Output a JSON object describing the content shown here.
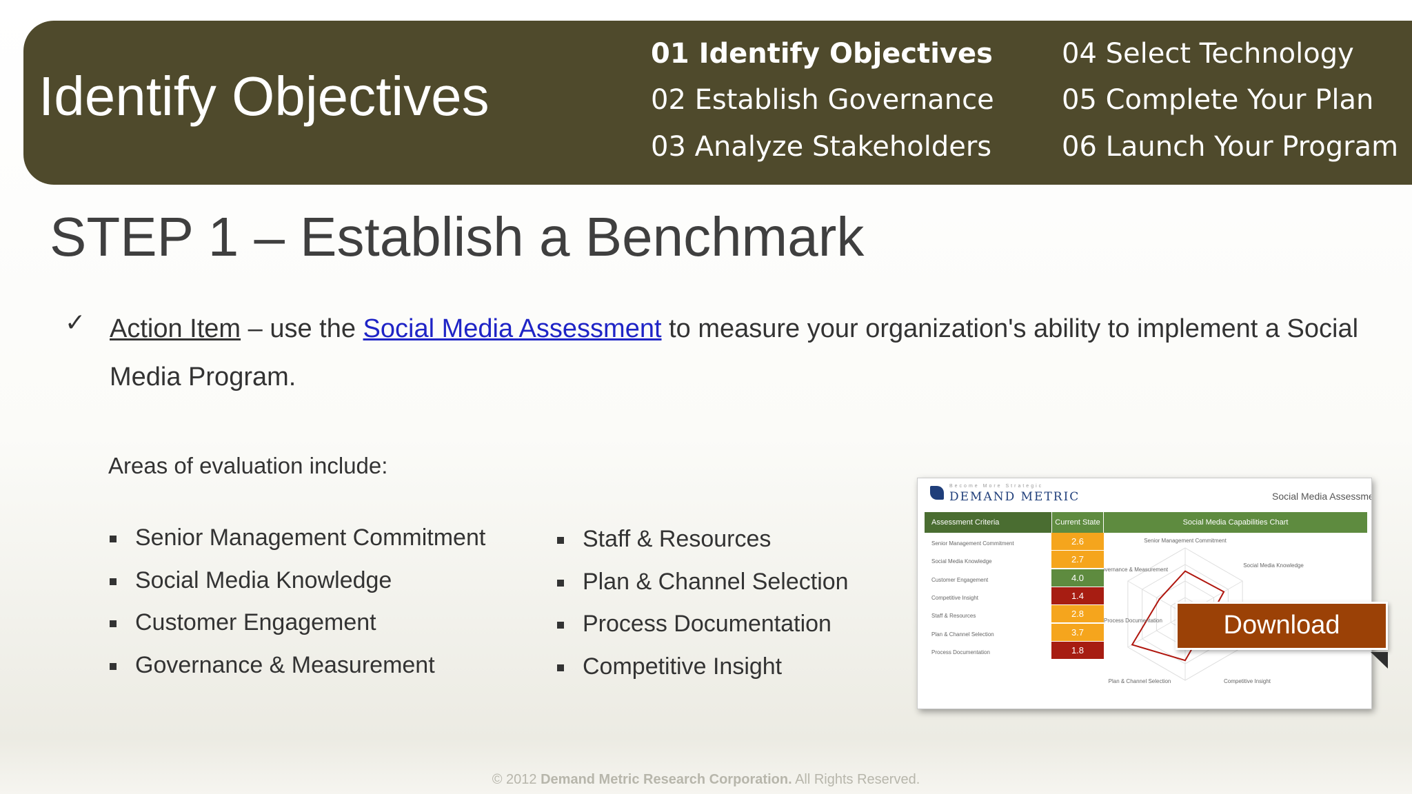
{
  "header": {
    "title": "Identify Objectives",
    "nav_items": [
      {
        "label": "01 Identify Objectives",
        "active": true
      },
      {
        "label": "02 Establish Governance",
        "active": false
      },
      {
        "label": "03 Analyze Stakeholders",
        "active": false
      },
      {
        "label": "04 Select Technology",
        "active": false
      },
      {
        "label": "05 Complete Your Plan",
        "active": false
      },
      {
        "label": "06 Launch Your Program",
        "active": false
      }
    ]
  },
  "main": {
    "step_title": "STEP 1 – Establish a Benchmark",
    "action": {
      "check_icon": "✓",
      "label": "Action Item",
      "before_link": " – use the ",
      "link": "Social Media Assessment",
      "after_link": " to measure your organization's ability to implement a Social Media Program."
    },
    "areas_intro": "Areas of evaluation include:",
    "areas_left": [
      "Senior Management Commitment",
      "Social Media Knowledge",
      "Customer Engagement",
      "Governance & Measurement"
    ],
    "areas_right": [
      "Staff & Resources",
      "Plan & Channel Selection",
      "Process Documentation",
      "Competitive Insight"
    ]
  },
  "preview": {
    "tagline": "Become More Strategic",
    "brand": "DEMAND METRIC",
    "doc_title": "Social Media Assessment",
    "headers": [
      "Assessment Criteria",
      "Current State",
      "Social Media Capabilities Chart"
    ],
    "rows": [
      {
        "label": "Senior Management Commitment",
        "value": "2.6",
        "color": "#f5a51d"
      },
      {
        "label": "Social Media Knowledge",
        "value": "2.7",
        "color": "#f5a51d"
      },
      {
        "label": "Customer Engagement",
        "value": "4.0",
        "color": "#5e8b3f"
      },
      {
        "label": "Competitive Insight",
        "value": "1.4",
        "color": "#a71d12"
      },
      {
        "label": "Staff & Resources",
        "value": "2.8",
        "color": "#f5a51d"
      },
      {
        "label": "Plan & Channel Selection",
        "value": "3.7",
        "color": "#f5a51d"
      },
      {
        "label": "Process Documentation",
        "value": "1.8",
        "color": "#a71d12"
      }
    ],
    "radar_labels": {
      "senior": "Senior Management Commitment",
      "governance": "Governance & Measurement",
      "knowledge": "Social Media Knowledge",
      "process": "Process Documentation",
      "plan": "Plan & Channel Selection",
      "competitive": "Competitive Insight"
    }
  },
  "download": {
    "label": "Download",
    "color": "#9b4106"
  },
  "footer": {
    "symbol": "©",
    "year": "2012",
    "company": "Demand Metric Research Corporation.",
    "rights": "All Rights Reserved."
  }
}
